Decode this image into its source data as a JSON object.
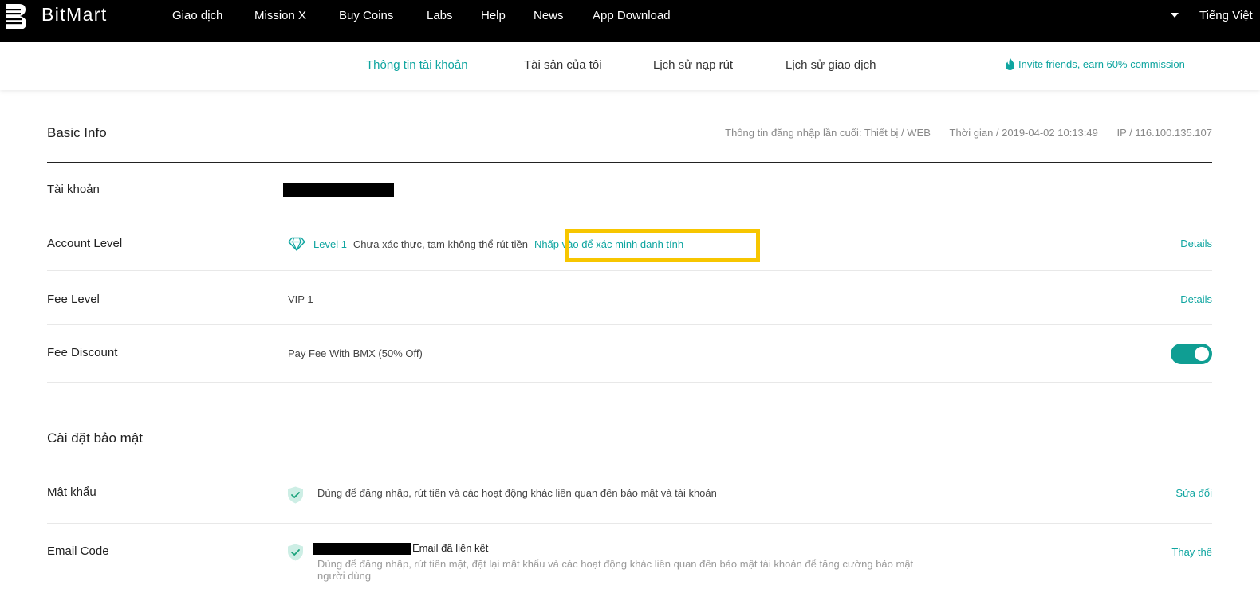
{
  "brand": {
    "name": "BitMart"
  },
  "topnav": {
    "items": [
      "Giao dịch",
      "Mission X",
      "Buy Coins",
      "Labs",
      "Help",
      "News",
      "App Download"
    ],
    "language": "Tiếng Việt"
  },
  "subnav": {
    "items": [
      "Thông tin tài khoản",
      "Tài sản của tôi",
      "Lịch sử nạp rút",
      "Lịch sử giao dịch"
    ],
    "active_index": 0,
    "invite": "Invite friends, earn 60% commission"
  },
  "basic_info": {
    "title": "Basic Info",
    "last_login": {
      "device": "Thông tin đăng nhập lần cuối: Thiết bị / WEB",
      "time": "Thời gian / 2019-04-02 10:13:49",
      "ip": "IP / 116.100.135.107"
    },
    "account": {
      "label": "Tài khoản"
    },
    "account_level": {
      "label": "Account Level",
      "level": "Level 1",
      "status": "Chưa xác thực, tạm không thể rút tiền",
      "verify_link": "Nhấp vào để xác minh danh tính",
      "action": "Details"
    },
    "fee_level": {
      "label": "Fee Level",
      "value": "VIP 1",
      "action": "Details"
    },
    "fee_discount": {
      "label": "Fee Discount",
      "value": "Pay Fee With BMX (50% Off)",
      "enabled": true
    }
  },
  "security": {
    "title": "Cài đặt bảo mật",
    "password": {
      "label": "Mật khẩu",
      "description": "Dùng để đăng nhập, rút tiền và các hoạt động khác liên quan đến bảo mật và tài khoản",
      "action": "Sửa đổi"
    },
    "email_code": {
      "label": "Email Code",
      "bound_text": "Email đã liên kết",
      "description": "Dùng để đăng nhập, rút tiền mặt, đặt lại mật khẩu và các hoạt động khác liên quan đến bảo mật tài khoản để tăng cường bảo mật người dùng",
      "action": "Thay thế"
    }
  },
  "colors": {
    "accent": "#0fa5a0",
    "highlight": "#f7c600",
    "nav_bg": "#000000"
  },
  "icons": [
    "bitmart-logo-icon",
    "chevron-down-icon",
    "fire-icon",
    "diamond-icon",
    "shield-check-icon"
  ]
}
